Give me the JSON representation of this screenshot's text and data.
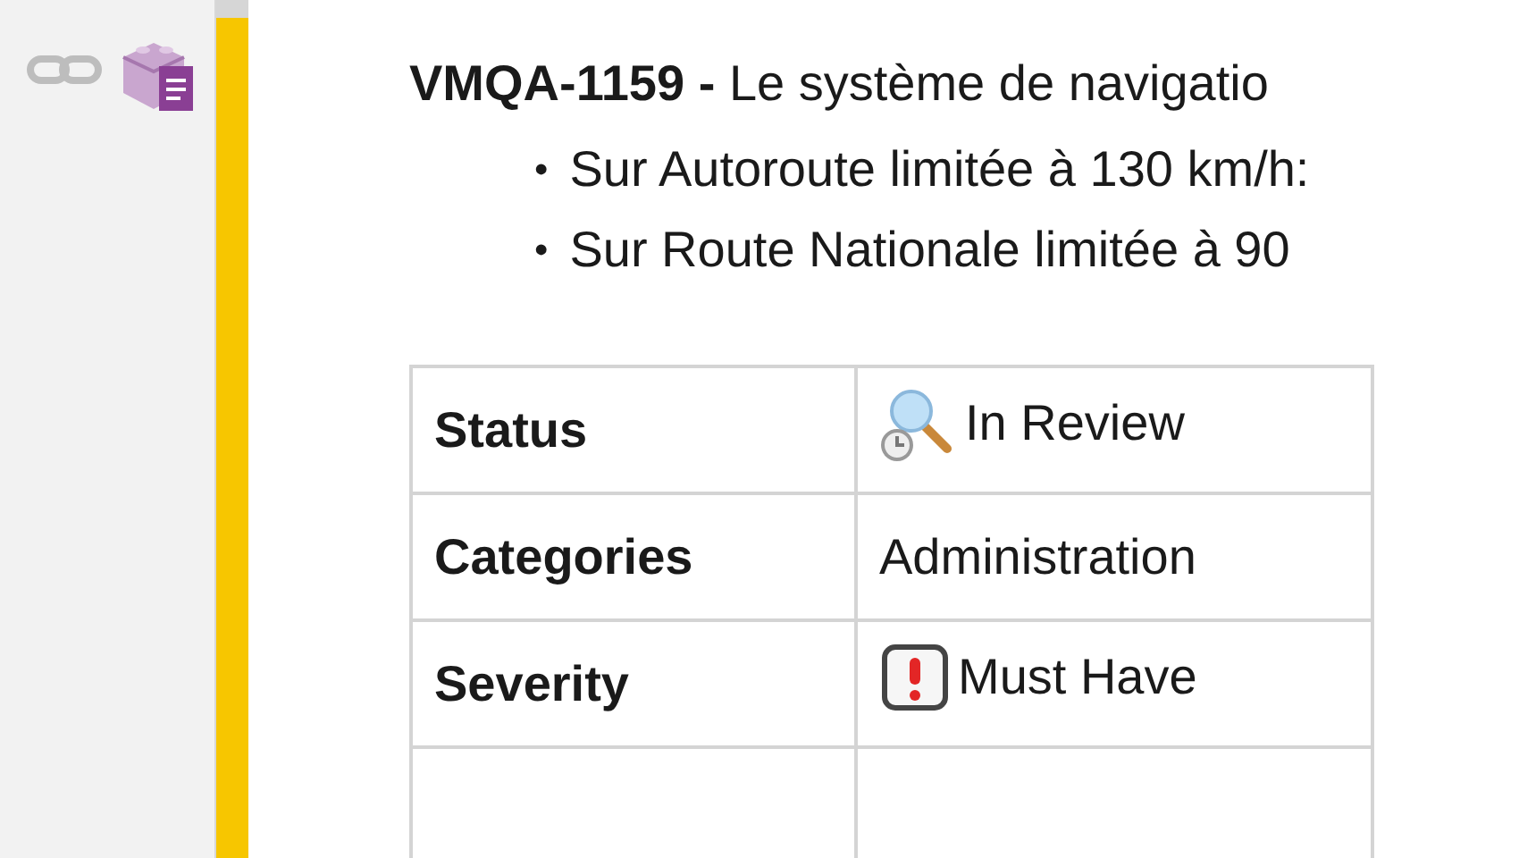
{
  "issue": {
    "key": "VMQA-1159 -",
    "summary": "Le système de navigatio"
  },
  "bullets": [
    {
      "marker": "•",
      "text": "Sur Autoroute limitée à 130 km/h:"
    },
    {
      "marker": "•",
      "text": "Sur Route Nationale limitée à 90"
    }
  ],
  "table": {
    "rows": [
      {
        "label": "Status",
        "value": "In Review",
        "kind": "review"
      },
      {
        "label": "Categories",
        "value": "Administration",
        "kind": "plain"
      },
      {
        "label": "Severity",
        "value": "Must Have",
        "kind": "priority"
      },
      {
        "label": "",
        "value": "",
        "kind": "plain"
      }
    ]
  }
}
